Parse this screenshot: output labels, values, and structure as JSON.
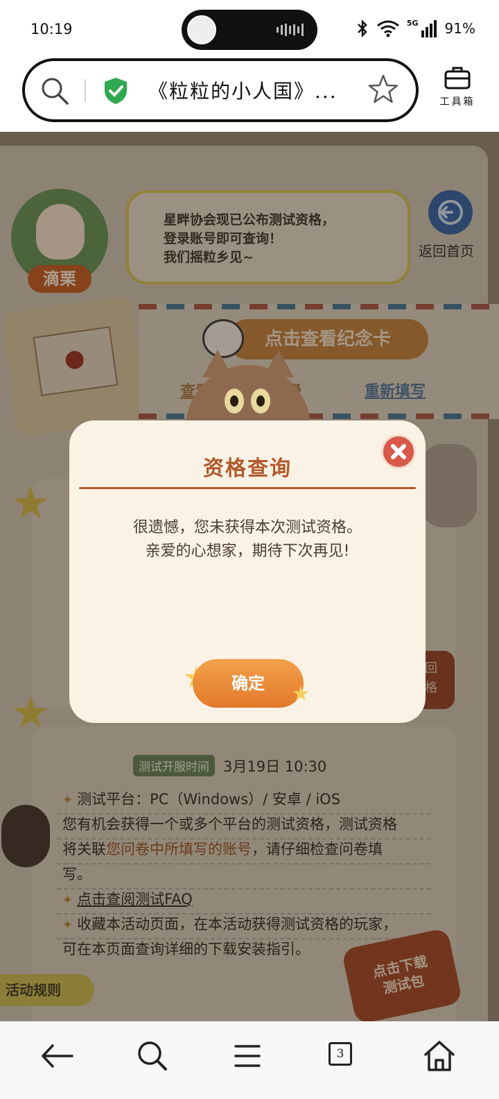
{
  "status_bar": {
    "time": "10:19",
    "battery": "91%",
    "network": "5G",
    "icons": [
      "bluetooth-icon",
      "wifi-icon",
      "signal-icon"
    ]
  },
  "browser": {
    "tab_title": "《粒粒的小人国》...",
    "toolbox_label": "工具箱",
    "icons": [
      "search-icon",
      "shield-check-icon",
      "star-icon",
      "toolbox-icon"
    ]
  },
  "page": {
    "character_name": "滴栗",
    "speech_text": [
      "星畔协会现已公布测试资格，",
      "登录账号即可查询！",
      "我们摇粒乡见~"
    ],
    "home_label": "返回首页",
    "card_button": "点击查看纪念卡",
    "link_record": "查看问卷填写记录",
    "link_refill": "重新填写",
    "right_tag": [
      "回",
      "格"
    ],
    "server_badge": "测试开服时间",
    "server_time": "3月19日  10:30",
    "platform_line": "测试平台：PC（Windows）/ 安卓 / iOS",
    "qual_line_1": "您有机会获得一个或多个平台的测试资格，测试资格",
    "qual_line_2_prefix": "将关联",
    "qual_line_2_highlight": "您问卷中所填写的账号",
    "qual_line_2_suffix": "，请仔细检查问卷填",
    "qual_line_3": "写。",
    "faq_link": "点击查阅测试FAQ",
    "bookmark_line_1": "收藏本活动页面，在本活动获得测试资格的玩家，",
    "bookmark_line_2": "可在本页面查询详细的下载安装指引。",
    "download_button": [
      "点击下载",
      "测试包"
    ],
    "rules_tab": "活动规则"
  },
  "modal": {
    "title": "资格查询",
    "message_line_1": "很遗憾，您未获得本次测试资格。",
    "message_line_2": "亲爱的心想家，期待下次再见!",
    "confirm_label": "确定"
  },
  "bottom_nav": {
    "tab_count": "3",
    "items": [
      "back-icon",
      "search-icon",
      "menu-icon",
      "tabs-icon",
      "home-icon"
    ]
  },
  "colors": {
    "modal_title": "#b05a2c",
    "confirm_button": "#e27a2c",
    "close_button": "#d8584a",
    "shield": "#2fa84f"
  }
}
